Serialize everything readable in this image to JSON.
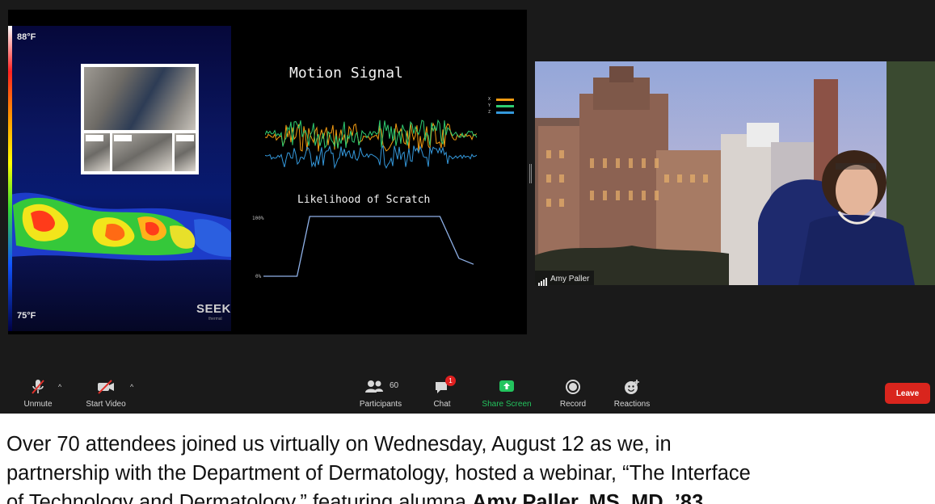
{
  "shared_screen": {
    "temp_high": "88°F",
    "temp_low": "75°F",
    "logo": "SEEK",
    "logo_sub": "thermal",
    "motion_title": "Motion Signal",
    "scratch_title": "Likelihood of Scratch",
    "pct_high": "100%",
    "pct_low": "0%",
    "axes": [
      "X",
      "Y",
      "Z"
    ],
    "axis_colors": [
      "#f39c12",
      "#2ecc71",
      "#3498db"
    ],
    "likelihood_curve": [
      {
        "t": 0,
        "p": 0
      },
      {
        "t": 0.16,
        "p": 0
      },
      {
        "t": 0.22,
        "p": 1
      },
      {
        "t": 0.84,
        "p": 1
      },
      {
        "t": 0.93,
        "p": 0.3
      },
      {
        "t": 1,
        "p": 0.2
      }
    ]
  },
  "video": {
    "participant_name": "Amy Paller"
  },
  "toolbar": {
    "unmute": "Unmute",
    "start_video": "Start Video",
    "participants": "Participants",
    "participant_count": "60",
    "chat": "Chat",
    "chat_badge": "1",
    "share_screen": "Share Screen",
    "record": "Record",
    "reactions": "Reactions",
    "leave": "Leave"
  },
  "article": {
    "line1": "Over 70 attendees joined us virtually on Wednesday, August 12 as we, in",
    "line2": "partnership with the Department of Dermatology, hosted a webinar, “The Interface",
    "line3_start": "of Technology and Dermatology,” featuring alumna ",
    "line3_bold": "Amy Paller, MS, MD, ’83"
  },
  "colors": {
    "leave_red": "#d9251d",
    "share_green": "#23c45e",
    "chat_badge": "#e02020"
  }
}
